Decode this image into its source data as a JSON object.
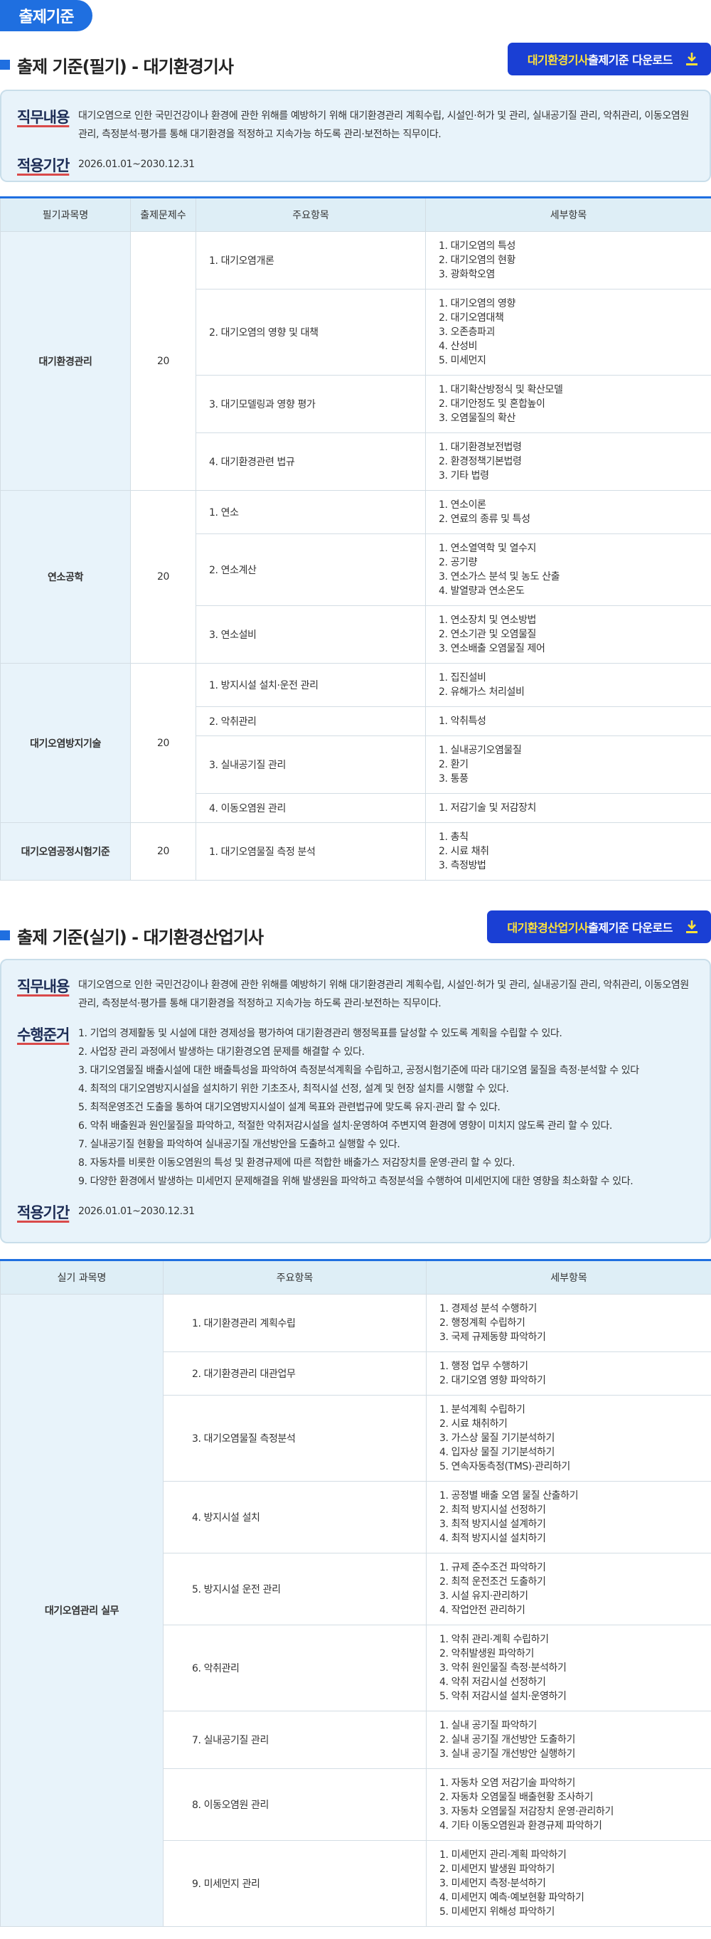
{
  "page_badge": "출제기준",
  "written": {
    "title": "출제 기준(필기) - 대기환경기사",
    "download": {
      "highlight": "대기환경기사",
      "label": " 출제기준 다운로드",
      "icon": "download-arrow-icon"
    },
    "info": {
      "job_label": "직무내용",
      "job_text": "대기오염으로 인한 국민건강이나 환경에 관한 위해를 예방하기 위해 대기환경관리 계획수립, 시설인·허가 및 관리, 실내공기질 관리, 악취관리, 이동오염원 관리, 측정분석·평가를 통해 대기환경을 적정하고 지속가능 하도록 관리·보전하는 직무이다.",
      "period_label": "적용기간",
      "period_text": "2026.01.01~2030.12.31"
    },
    "headers": [
      "필기과목명",
      "출제문제수",
      "주요항목",
      "세부항목"
    ],
    "subjects": [
      {
        "name": "대기환경관리",
        "count": "20",
        "items": [
          {
            "main": "1. 대기오염개론",
            "details": [
              "1. 대기오염의 특성",
              "2. 대기오염의 현황",
              "3. 광화학오염"
            ]
          },
          {
            "main": "2. 대기오염의 영향 및 대책",
            "details": [
              "1. 대기오염의 영향",
              "2. 대기오염대책",
              "3. 오존층파괴",
              "4. 산성비",
              "5. 미세먼지"
            ]
          },
          {
            "main": "3. 대기모델링과 영향 평가",
            "details": [
              "1. 대기확산방정식 및 확산모델",
              "2. 대기안정도 및 혼합높이",
              "3. 오염물질의 확산"
            ]
          },
          {
            "main": "4. 대기환경관련 법규",
            "details": [
              "1. 대기환경보전법령",
              "2. 환경정책기본법령",
              "3. 기타 법령"
            ]
          }
        ]
      },
      {
        "name": "연소공학",
        "count": "20",
        "items": [
          {
            "main": "1. 연소",
            "details": [
              "1. 연소이론",
              "2. 연료의 종류 및 특성"
            ]
          },
          {
            "main": "2. 연소계산",
            "details": [
              "1. 연소열역학 및 열수지",
              "2. 공기량",
              "3. 연소가스 분석 및 농도 산출",
              "4. 발열량과 연소온도"
            ]
          },
          {
            "main": "3. 연소설비",
            "details": [
              "1. 연소장치 및 연소방법",
              "2. 연소기관 및 오염물질",
              "3. 연소배출 오염물질 제어"
            ]
          }
        ]
      },
      {
        "name": "대기오염방지기술",
        "count": "20",
        "items": [
          {
            "main": "1. 방지시설 설치·운전 관리",
            "details": [
              "1. 집진설비",
              "2. 유해가스 처리설비"
            ]
          },
          {
            "main": "2. 악취관리",
            "details": [
              "1. 악취특성"
            ]
          },
          {
            "main": "3. 실내공기질 관리",
            "details": [
              "1. 실내공기오염물질",
              "2. 환기",
              "3. 통풍"
            ]
          },
          {
            "main": "4. 이동오염원 관리",
            "details": [
              "1. 저감기술 및 저감장치"
            ]
          }
        ]
      },
      {
        "name": "대기오염공정시험기준",
        "count": "20",
        "items": [
          {
            "main": "1. 대기오염물질 측정 분석",
            "details": [
              "1. 총칙",
              "2. 시료 채취",
              "3. 측정방법"
            ]
          }
        ]
      }
    ]
  },
  "practical": {
    "title": "출제 기준(실기) - 대기환경산업기사",
    "download": {
      "highlight": "대기환경산업기사",
      "label": " 출제기준 다운로드",
      "icon": "download-arrow-icon"
    },
    "info": {
      "job_label": "직무내용",
      "job_text": "대기오염으로 인한 국민건강이나 환경에 관한 위해를 예방하기 위해 대기환경관리 계획수립, 시설인·허가 및 관리, 실내공기질 관리, 악취관리, 이동오염원 관리, 측정분석·평가를 통해 대기환경을 적정하고 지속가능 하도록 관리·보전하는 직무이다.",
      "criteria_label": "수행준거",
      "criteria": [
        "1. 기업의 경제활동 및 시설에 대한 경제성을 평가하여 대기환경관리 행정목표를 달성할 수 있도록 계획을 수립할 수 있다.",
        "2. 사업장 관리 과정에서 발생하는 대기환경오염 문제를 해결할 수 있다.",
        "3. 대기오염물질 배출시설에 대한 배출특성을 파악하여 측정분석계획을 수립하고, 공정시험기준에 따라 대기오염 물질을 측정·분석할 수 있다",
        "4. 최적의 대기오염방지시설을 설치하기 위한 기초조사, 최적시설 선정, 설계 및 현장 설치를 시행할 수 있다.",
        "5. 최적운영조건 도출을 통하여 대기오염방지시설이 설계 목표와 관련법규에 맞도록 유지·관리 할 수 있다.",
        "6. 악취 배출원과 원인물질을 파악하고, 적절한 악취저감시설을 설치·운영하여 주변지역 환경에 영향이 미치지 않도록 관리 할 수 있다.",
        "7. 실내공기질 현황을 파악하여 실내공기질 개선방안을 도출하고 실행할 수 있다.",
        "8. 자동차를 비롯한 이동오염원의 특성 및 환경규제에 따른 적합한 배출가스 저감장치를 운영·관리 할 수 있다.",
        "9. 다양한 환경에서 발생하는 미세먼지 문제해결을 위해 발생원을 파악하고 측정분석을 수행하여 미세먼지에 대한 영향을 최소화할 수 있다."
      ],
      "period_label": "적용기간",
      "period_text": "2026.01.01~2030.12.31"
    },
    "headers": [
      "실기 과목명",
      "주요항목",
      "세부항목"
    ],
    "subject": {
      "name": "대기오염관리 실무",
      "items": [
        {
          "main": "1. 대기환경관리 계획수립",
          "details": [
            "1. 경제성 분석 수행하기",
            "2. 행정계획 수립하기",
            "3. 국제 규제동향 파악하기"
          ]
        },
        {
          "main": "2. 대기환경관리 대관업무",
          "details": [
            "1. 행정 업무 수행하기",
            "2. 대기오염 영향 파악하기"
          ]
        },
        {
          "main": "3. 대기오염물질 측정분석",
          "details": [
            "1. 분석계획 수립하기",
            "2. 시료 채취하기",
            "3. 가스상 물질 기기분석하기",
            "4. 입자상 물질 기기분석하기",
            "5. 연속자동측정(TMS)·관리하기"
          ]
        },
        {
          "main": "4. 방지시설 설치",
          "details": [
            "1. 공정별 배출 오염 물질 산출하기",
            "2. 최적 방지시설 선정하기",
            "3. 최적 방지시설 설계하기",
            "4. 최적 방지시설 설치하기"
          ]
        },
        {
          "main": "5. 방지시설 운전 관리",
          "details": [
            "1. 규제 준수조건 파악하기",
            "2. 최적 운전조건 도출하기",
            "3. 시설 유지·관리하기",
            "4. 작업안전 관리하기"
          ]
        },
        {
          "main": "6. 악취관리",
          "details": [
            "1. 악취 관리·계획 수립하기",
            "2. 악취발생원 파악하기",
            "3. 악취 원인물질 측정·분석하기",
            "4. 악취 저감시설 선정하기",
            "5. 악취 저감시설 설치·운영하기"
          ]
        },
        {
          "main": "7. 실내공기질 관리",
          "details": [
            "1. 실내 공기질 파악하기",
            "2. 실내 공기질 개선방안 도출하기",
            "3. 실내 공기질 개선방안 실행하기"
          ]
        },
        {
          "main": "8. 이동오염원 관리",
          "details": [
            "1. 자동차 오염 저감기술 파악하기",
            "2. 자동차 오염물질 배출현황 조사하기",
            "3. 자동차 오염물질 저감장치 운영·관리하기",
            "4. 기타 이동오염원과 환경규제 파악하기"
          ]
        },
        {
          "main": "9. 미세먼지 관리",
          "details": [
            "1. 미세먼지 관리·계획 파악하기",
            "2. 미세먼지 발생원 파악하기",
            "3. 미세먼지 측정·분석하기",
            "4. 미세먼지 예측·예보현황 파악하기",
            "5. 미세먼지 위해성 파악하기"
          ]
        }
      ]
    }
  }
}
